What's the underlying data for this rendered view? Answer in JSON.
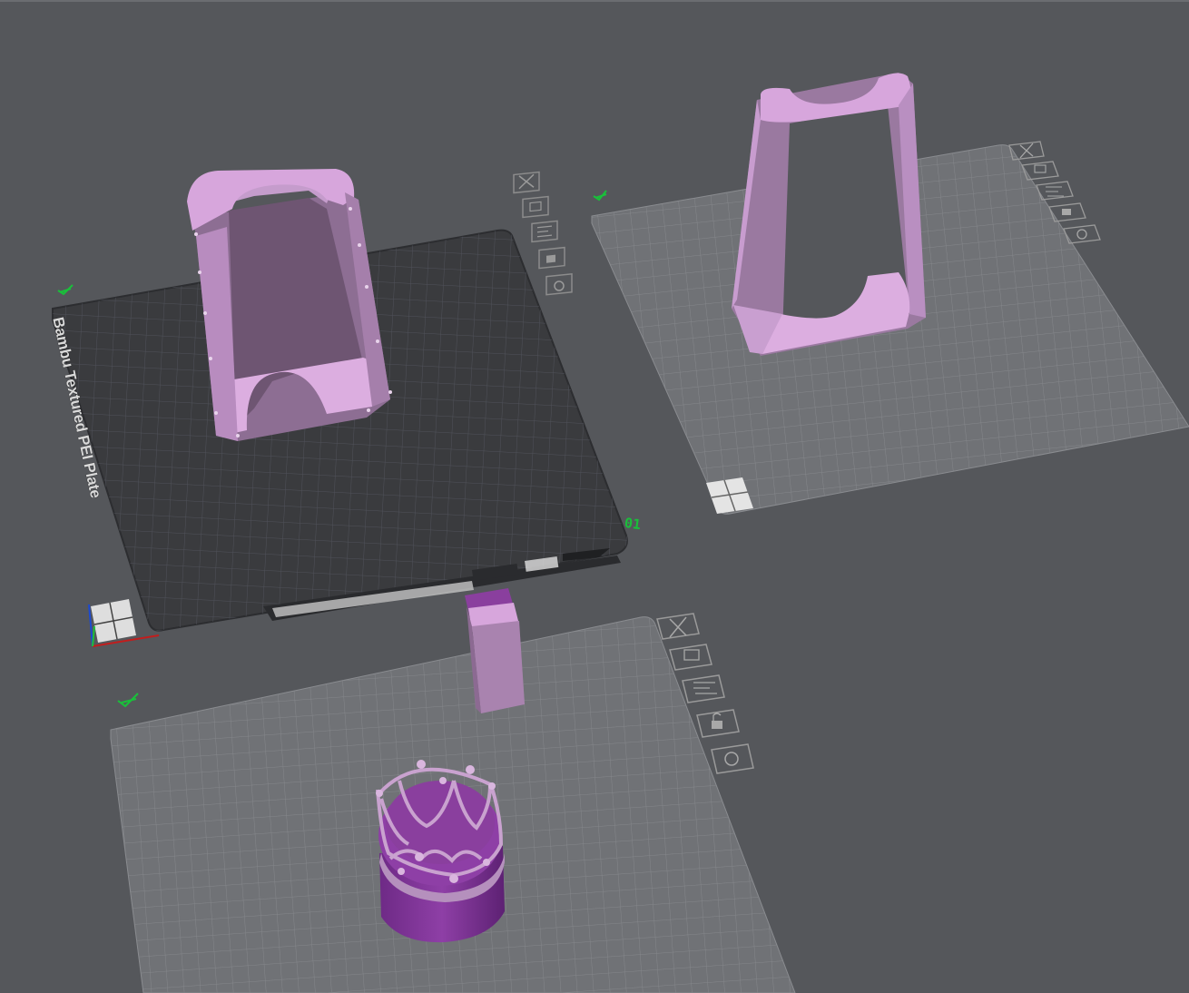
{
  "plates": [
    {
      "name": "Bambu Textured PEI Plate",
      "number": "01",
      "active": true
    },
    {
      "name": "",
      "number": "",
      "active": false
    },
    {
      "name": "",
      "number": "",
      "active": false
    }
  ],
  "plate_toolbar_icons": [
    "close-icon",
    "arrange-icon",
    "orient-icon",
    "lock-icon",
    "settings-icon"
  ],
  "colors": {
    "background": "#55575b",
    "active_bed": "#3a3b3e",
    "inactive_bed": "#707276",
    "model_light": "#d7a6dc",
    "model_shadow": "#8d6e93",
    "model_purple": "#8a3f9e",
    "plate_marker": "#19c03a"
  }
}
